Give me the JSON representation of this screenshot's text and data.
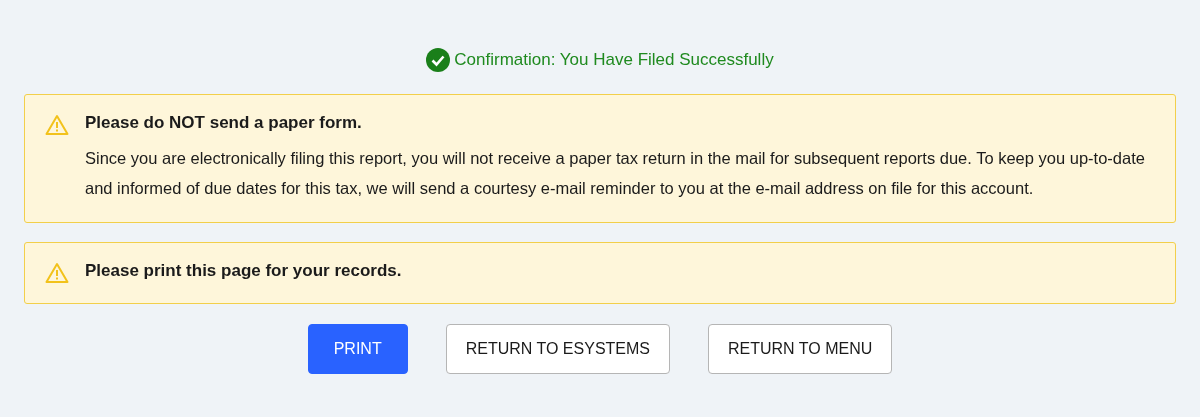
{
  "confirmation": {
    "text": "Confirmation: You Have Filed Successfully"
  },
  "alerts": [
    {
      "title": "Please do NOT send a paper form.",
      "body": "Since you are electronically filing this report, you will not receive a paper tax return in the mail for subsequent reports due. To keep you up-to-date and informed of due dates for this tax, we will send a courtesy e-mail reminder to you at the e-mail address on file for this account."
    },
    {
      "title": "Please print this page for your records."
    }
  ],
  "buttons": [
    {
      "label": "PRINT",
      "kind": "primary"
    },
    {
      "label": "RETURN TO ESYSTEMS",
      "kind": "secondary"
    },
    {
      "label": "RETURN TO MENU",
      "kind": "secondary"
    }
  ]
}
